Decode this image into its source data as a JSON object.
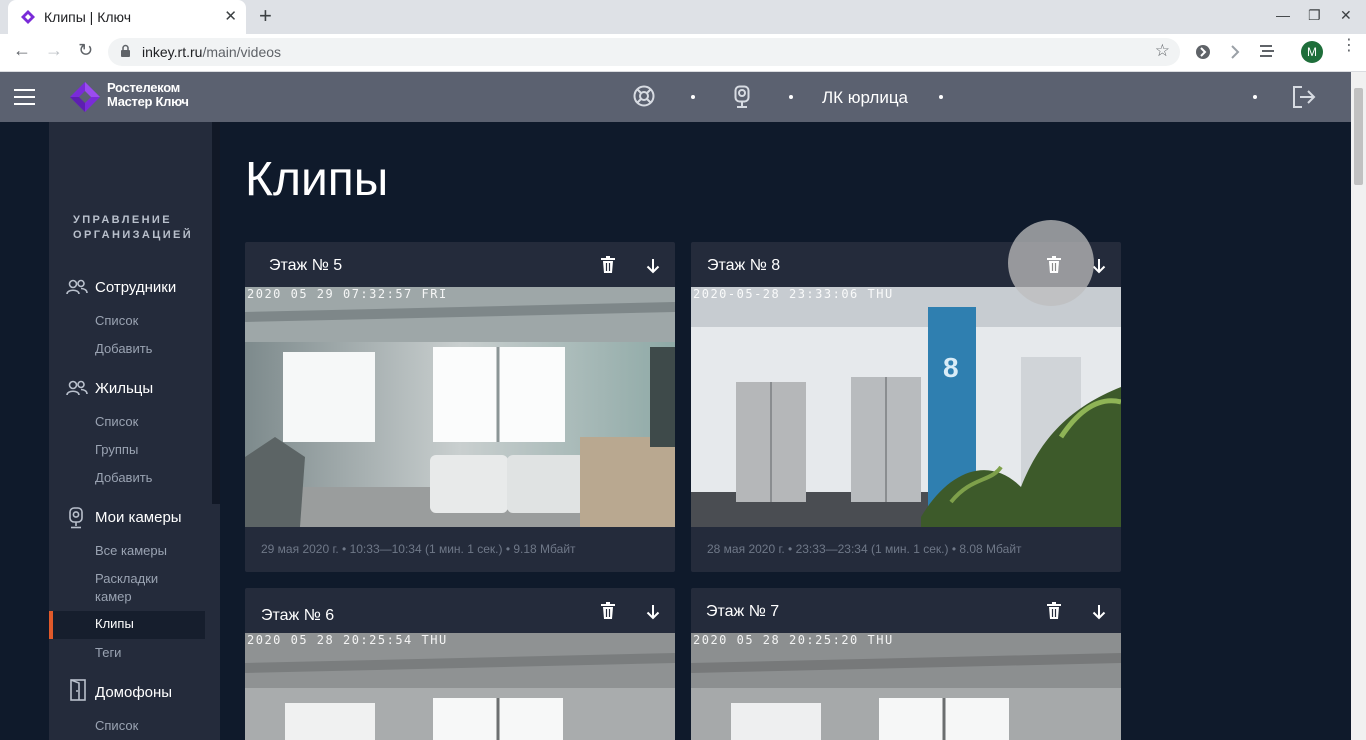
{
  "browser": {
    "tab_title": "Клипы | Ключ",
    "url_host": "inkey.rt.ru",
    "url_path": "/main/videos",
    "avatar_letter": "M"
  },
  "header": {
    "logo_line1": "Ростелеком",
    "logo_line2": "Мастер Ключ",
    "org_link": "ЛК юрлица"
  },
  "sidebar": {
    "heading_line1": "УПРАВЛЕНИЕ",
    "heading_line2": "ОРГАНИЗАЦИЕЙ",
    "employees": {
      "label": "Сотрудники",
      "items": [
        "Список",
        "Добавить"
      ]
    },
    "residents": {
      "label": "Жильцы",
      "items": [
        "Список",
        "Группы",
        "Добавить"
      ]
    },
    "cameras": {
      "label": "Мои камеры",
      "items": [
        "Все камеры",
        "Раскладки камер",
        "Клипы",
        "Теги"
      ],
      "layouts_line1": "Раскладки",
      "layouts_line2": "камер"
    },
    "intercoms": {
      "label": "Домофоны",
      "items": [
        "Список"
      ]
    }
  },
  "main": {
    "title": "Клипы",
    "clips": [
      {
        "title": "Этаж № 5",
        "stamp": "2020 05 29 07:32:57 FRI",
        "meta": "29 мая 2020 г. • 10:33—10:34 (1 мин. 1 сек.) • 9.18 Мбайт"
      },
      {
        "title": "Этаж № 8",
        "stamp": "2020-05-28 23:33:06 THU",
        "meta": "28 мая 2020 г. • 23:33—23:34 (1 мин. 1 сек.) • 8.08 Мбайт"
      },
      {
        "title": "Этаж № 6",
        "stamp": "2020 05 28 20:25:54 THU",
        "meta": ""
      },
      {
        "title": "Этаж № 7",
        "stamp": "2020 05 28 20:25:20 THU",
        "meta": ""
      }
    ]
  },
  "colors": {
    "accent": "#e0592a",
    "header": "#5b6170",
    "sidebar": "#242b3b",
    "background": "#0f1a2b",
    "brand": "#7a2bd8"
  }
}
